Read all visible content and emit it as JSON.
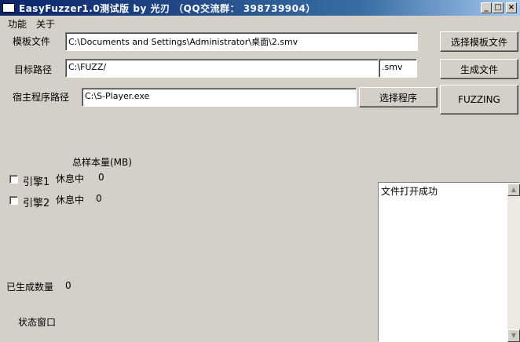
{
  "window": {
    "title": "EasyFuzzer1.0测试版  by 光刃  （QQ交流群： 398739904）",
    "min": "_",
    "max": "□",
    "close": "×"
  },
  "menu": {
    "items": [
      "功能",
      "关于"
    ]
  },
  "template": {
    "label": "模板文件",
    "value": "C:\\Documents and Settings\\Administrator\\桌面\\2.smv",
    "button": "选择模板文件"
  },
  "target": {
    "label": "目标路径",
    "value": "C:\\FUZZ/",
    "ext": ".smv",
    "button": "生成文件"
  },
  "host": {
    "label": "宿主程序路径",
    "value": "C:\\S-Player.exe",
    "button": "选择程序",
    "fuzz_button": "FUZZING"
  },
  "samples": {
    "label": "总样本量(MB)"
  },
  "engines": [
    {
      "label": "引擎1",
      "status": "休息中",
      "count": "0"
    },
    {
      "label": "引擎2",
      "status": "休息中",
      "count": "0"
    }
  ],
  "generated": {
    "label": "已生成数量",
    "value": "0"
  },
  "status_window": {
    "label": "状态窗口"
  },
  "log": {
    "text": "文件打开成功"
  },
  "colors": {
    "titlebar_start": "#0a246a",
    "titlebar_end": "#a6caf0",
    "face": "#d4d0c8"
  }
}
